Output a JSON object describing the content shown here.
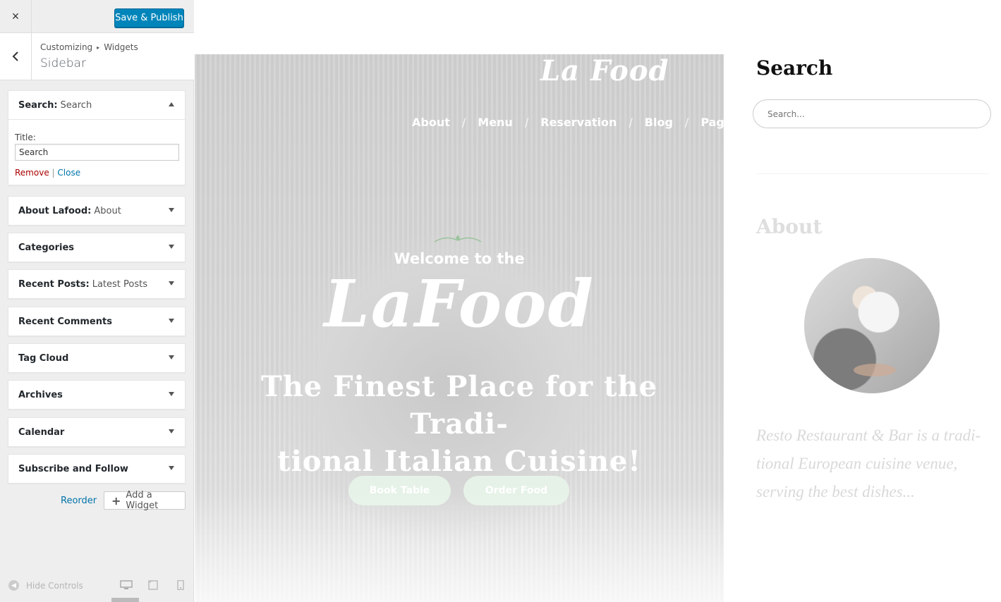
{
  "topbar": {
    "close_label": "×",
    "publish_label": "Save & Publish"
  },
  "breadcrumb": {
    "root": "Customizing",
    "separator": "▸",
    "parent": "Widgets",
    "section": "Sidebar"
  },
  "widgets": [
    {
      "type": "Search:",
      "title": " Search",
      "expanded": true
    },
    {
      "type": "About Lafood:",
      "title": " About"
    },
    {
      "type": "Categories",
      "title": ""
    },
    {
      "type": "Recent Posts:",
      "title": " Latest Posts"
    },
    {
      "type": "Recent Comments",
      "title": ""
    },
    {
      "type": "Tag Cloud",
      "title": ""
    },
    {
      "type": "Archives",
      "title": ""
    },
    {
      "type": "Calendar",
      "title": ""
    },
    {
      "type": "Subscribe and Follow",
      "title": ""
    }
  ],
  "search_widget": {
    "field_label": "Title:",
    "field_value": "Search",
    "remove_label": "Remove",
    "divider": "|",
    "close_label": "Close"
  },
  "actions": {
    "reorder_label": "Reorder",
    "add_label": "Add a Widget"
  },
  "footer": {
    "hide_label": "Hide Controls",
    "devices": [
      "desktop-icon",
      "tablet-icon",
      "mobile-icon"
    ],
    "active_device": "desktop"
  },
  "preview": {
    "logo": "La Food",
    "nav": [
      "About",
      "Menu",
      "Reservation",
      "Blog",
      "Pages"
    ],
    "nav_separator": "/",
    "welcome": "Welcome to the",
    "big_logo": "LaFood",
    "tagline_line1": "The Finest Place for the Tradi-",
    "tagline_line2": "tional Italian Cuisine!",
    "buttons": [
      "Book Table",
      "Order Food"
    ],
    "sidebar": {
      "search_heading": "Search",
      "search_placeholder": "Search...",
      "about_heading": "About",
      "about_text": "Resto Restaurant & Bar is a tradi-tional European cuisine venue, serving the best dishes..."
    }
  },
  "colors": {
    "accent": "#0085ba",
    "link": "#0073aa",
    "remove": "#a00000",
    "panel_bg": "#eeeeee",
    "button_hero": "#e6f2e8"
  }
}
